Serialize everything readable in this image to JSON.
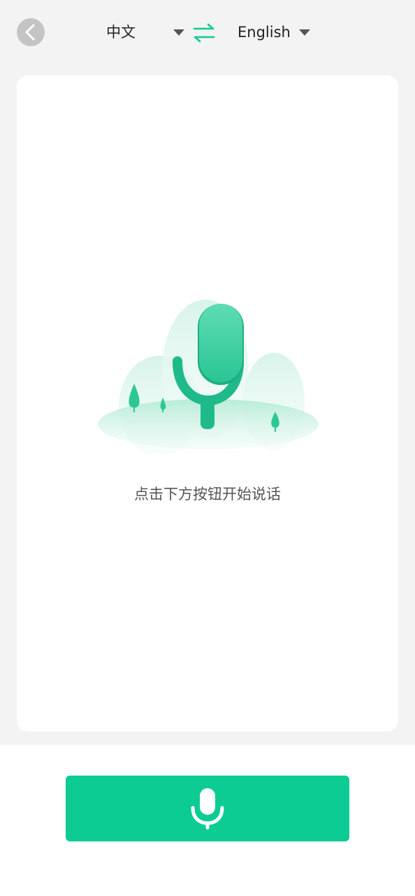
{
  "header": {
    "source_language": "中文",
    "target_language": "English",
    "back_icon": "chevron-left-icon",
    "swap_icon": "swap-arrows-icon",
    "dropdown_icon": "caret-down-icon"
  },
  "main": {
    "hint": "点击下方按钮开始说话",
    "illustration_icon": "microphone-landscape-illustration"
  },
  "footer": {
    "record_icon": "microphone-icon"
  },
  "colors": {
    "accent": "#0ccb93",
    "background": "#f3f3f3",
    "card": "#ffffff",
    "back_button": "#c4c4c4"
  }
}
